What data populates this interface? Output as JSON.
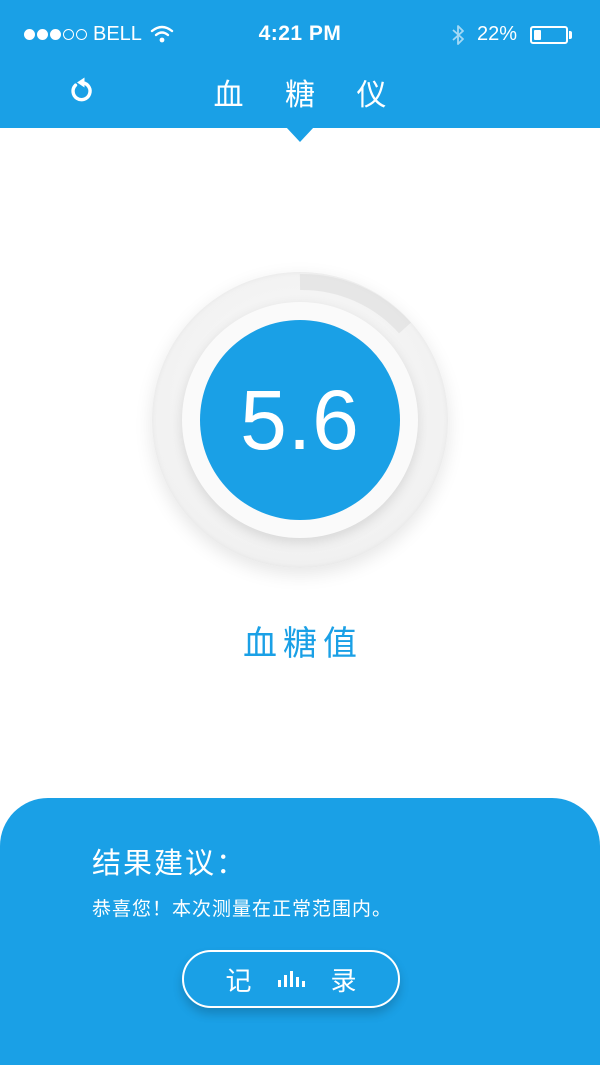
{
  "status_bar": {
    "carrier": "BELL",
    "time": "4:21 PM",
    "battery_percent": "22%",
    "battery_level": 0.22,
    "signal_bars_filled": 3,
    "signal_bars_total": 5
  },
  "header": {
    "title": "血 糖 仪",
    "back_icon": "refresh-icon"
  },
  "gauge": {
    "reading": "5.6",
    "label": "血糖值"
  },
  "result": {
    "title": "结果建议：",
    "message": "恭喜您！本次测量在正常范围内。",
    "record_button": {
      "left_char": "记",
      "right_char": "录",
      "icon": "bar-chart-icon"
    }
  },
  "colors": {
    "primary": "#1aa0e6",
    "background": "#ffffff",
    "text_on_primary": "#ffffff"
  }
}
